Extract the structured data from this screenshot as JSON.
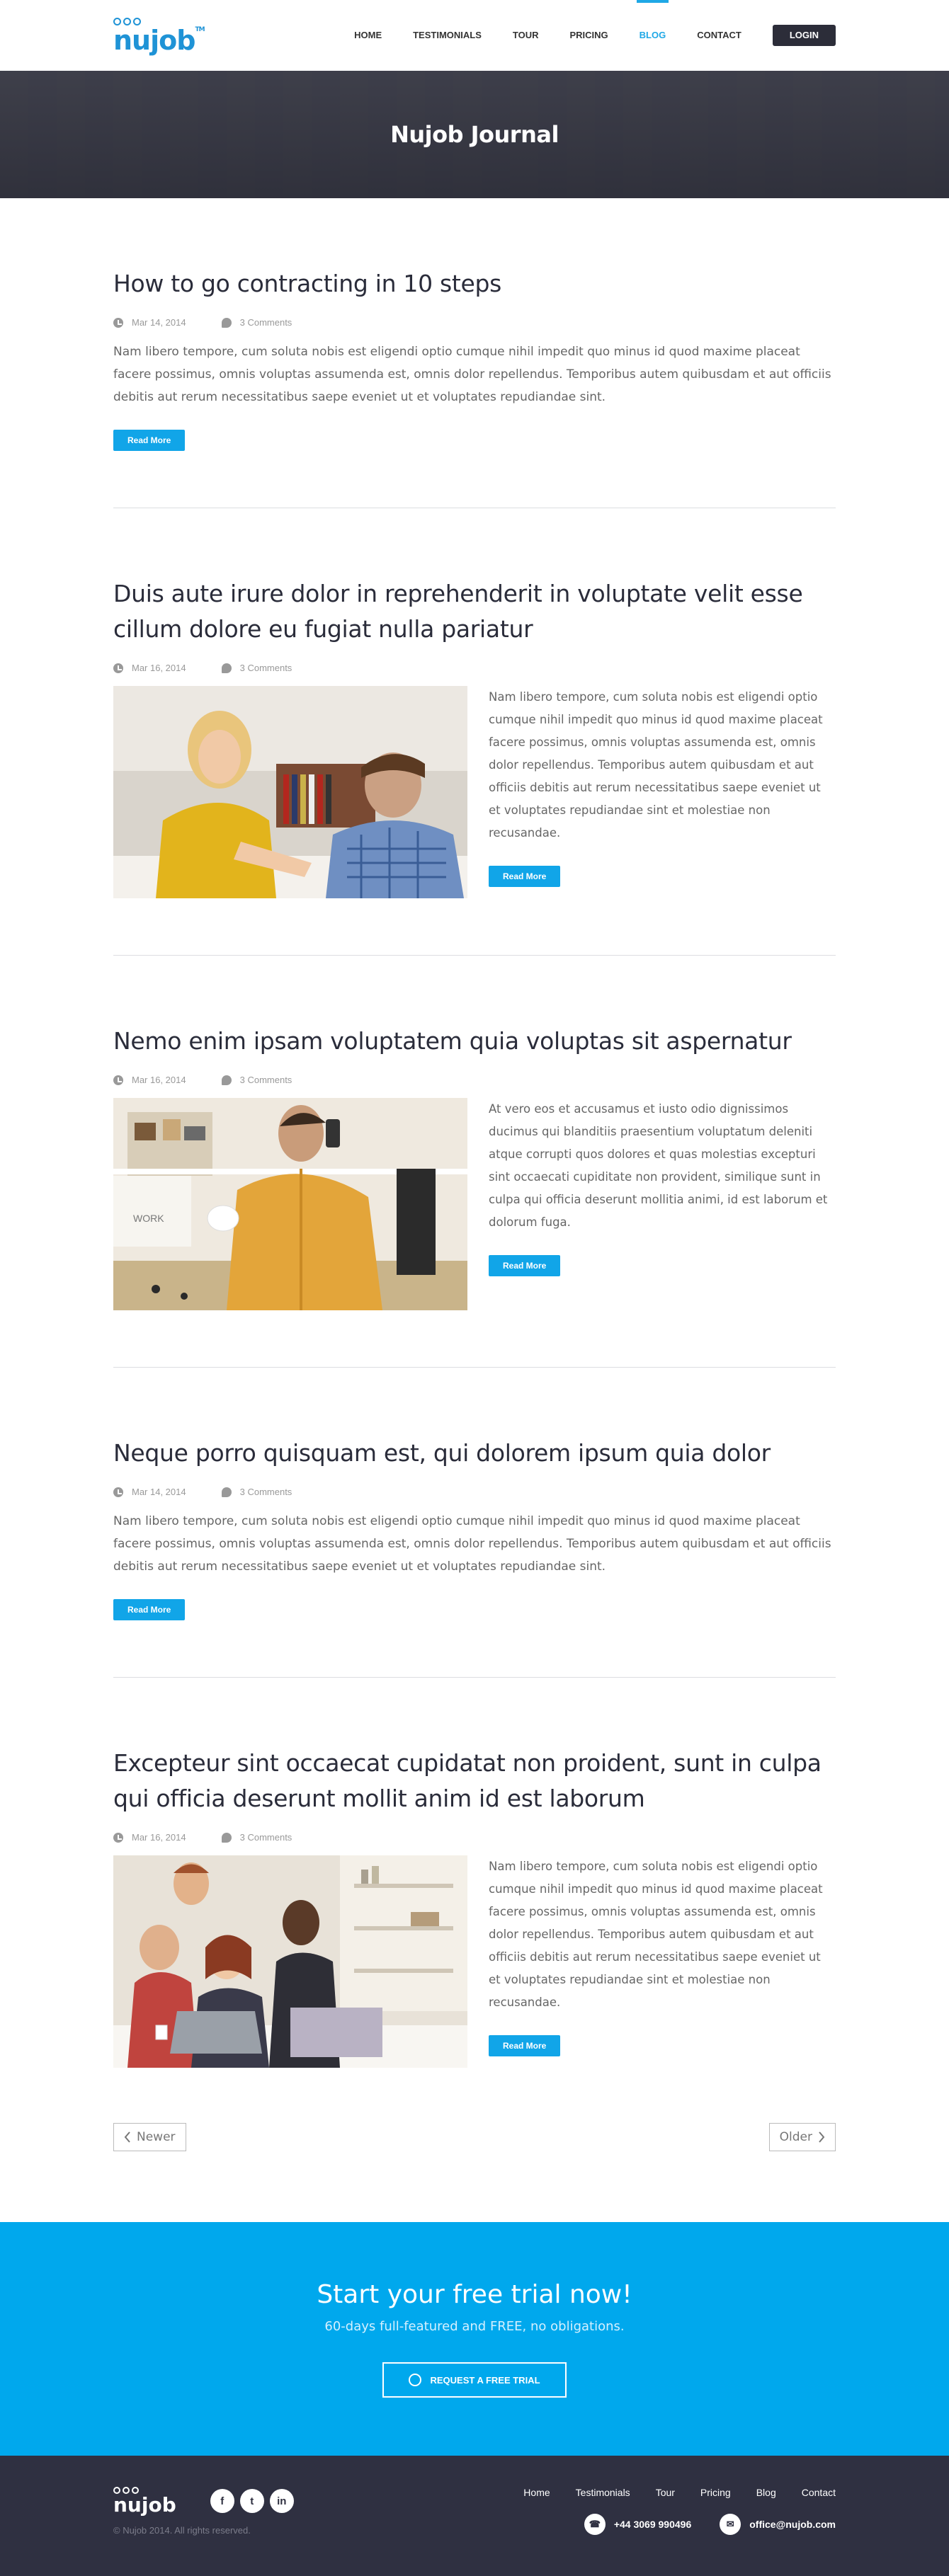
{
  "brand": {
    "name": "nujob",
    "tm": "TM"
  },
  "nav": {
    "items": [
      {
        "label": "HOME"
      },
      {
        "label": "TESTIMONIALS"
      },
      {
        "label": "TOUR"
      },
      {
        "label": "PRICING"
      },
      {
        "label": "BLOG"
      },
      {
        "label": "CONTACT"
      }
    ],
    "active": "BLOG",
    "login_label": "LOGIN"
  },
  "hero": {
    "title": "Nujob Journal"
  },
  "posts": [
    {
      "title": "How to go contracting in 10 steps",
      "date": "Mar 14, 2014",
      "comments": "3 Comments",
      "excerpt": "Nam libero tempore, cum soluta nobis est eligendi optio cumque nihil impedit quo minus id quod maxime placeat facere possimus, omnis voluptas assumenda est, omnis dolor repellendus. Temporibus autem quibusdam et aut officiis debitis aut rerum necessitatibus saepe eveniet ut et voluptates repudiandae sint.",
      "button": "Read More"
    },
    {
      "title": "Duis aute irure dolor in reprehenderit in voluptate velit esse cillum dolore eu fugiat nulla pariatur",
      "date": "Mar 16, 2014",
      "comments": "3 Comments",
      "excerpt": "Nam libero tempore, cum soluta nobis est eligendi optio cumque nihil impedit quo minus id quod maxime placeat facere possimus, omnis voluptas assumenda est, omnis dolor repellendus. Temporibus autem quibusdam et aut officiis debitis aut rerum necessitatibus saepe eveniet ut et voluptates repudiandae sint et molestiae non recusandae.",
      "button": "Read More"
    },
    {
      "title": "Nemo enim ipsam voluptatem quia voluptas sit aspernatur",
      "date": "Mar 16, 2014",
      "comments": "3 Comments",
      "excerpt": "At vero eos et accusamus et iusto odio dignissimos ducimus qui blanditiis praesentium voluptatum deleniti atque corrupti quos dolores et quas molestias excepturi sint occaecati cupiditate non provident, similique sunt in culpa qui officia deserunt mollitia animi, id est laborum et dolorum fuga.",
      "button": "Read More",
      "image_text": "WORK"
    },
    {
      "title": "Neque porro quisquam est, qui dolorem ipsum quia dolor",
      "date": "Mar 14, 2014",
      "comments": "3 Comments",
      "excerpt": "Nam libero tempore, cum soluta nobis est eligendi optio cumque nihil impedit quo minus id quod maxime placeat facere possimus, omnis voluptas assumenda est, omnis dolor repellendus. Temporibus autem quibusdam et aut officiis debitis aut rerum necessitatibus saepe eveniet ut et voluptates repudiandae sint.",
      "button": "Read More"
    },
    {
      "title": "Excepteur sint occaecat cupidatat non proident, sunt in culpa qui officia deserunt mollit anim id est laborum",
      "date": "Mar 16, 2014",
      "comments": "3 Comments",
      "excerpt": "Nam libero tempore, cum soluta nobis est eligendi optio cumque nihil impedit quo minus id quod maxime placeat facere possimus, omnis voluptas assumenda est, omnis dolor repellendus. Temporibus autem quibusdam et aut officiis debitis aut rerum necessitatibus saepe eveniet ut et voluptates repudiandae sint et molestiae non recusandae.",
      "button": "Read More"
    }
  ],
  "pager": {
    "newer": "Newer",
    "older": "Older"
  },
  "cta": {
    "title": "Start your free trial now!",
    "subtitle": "60-days full-featured and FREE, no obligations.",
    "button": "REQUEST A FREE TRIAL"
  },
  "footer": {
    "brand": "nujob",
    "copyright": "© Nujob 2014. All rights reserved.",
    "social": [
      "f",
      "t",
      "in"
    ],
    "links": [
      "Home",
      "Testimonials",
      "Tour",
      "Pricing",
      "Blog",
      "Contact"
    ],
    "phone": "+44 3069 990496",
    "email": "office@nujob.com"
  },
  "colors": {
    "accent": "#11a5e8",
    "dark": "#2f3041",
    "cta": "#00a8ed"
  }
}
